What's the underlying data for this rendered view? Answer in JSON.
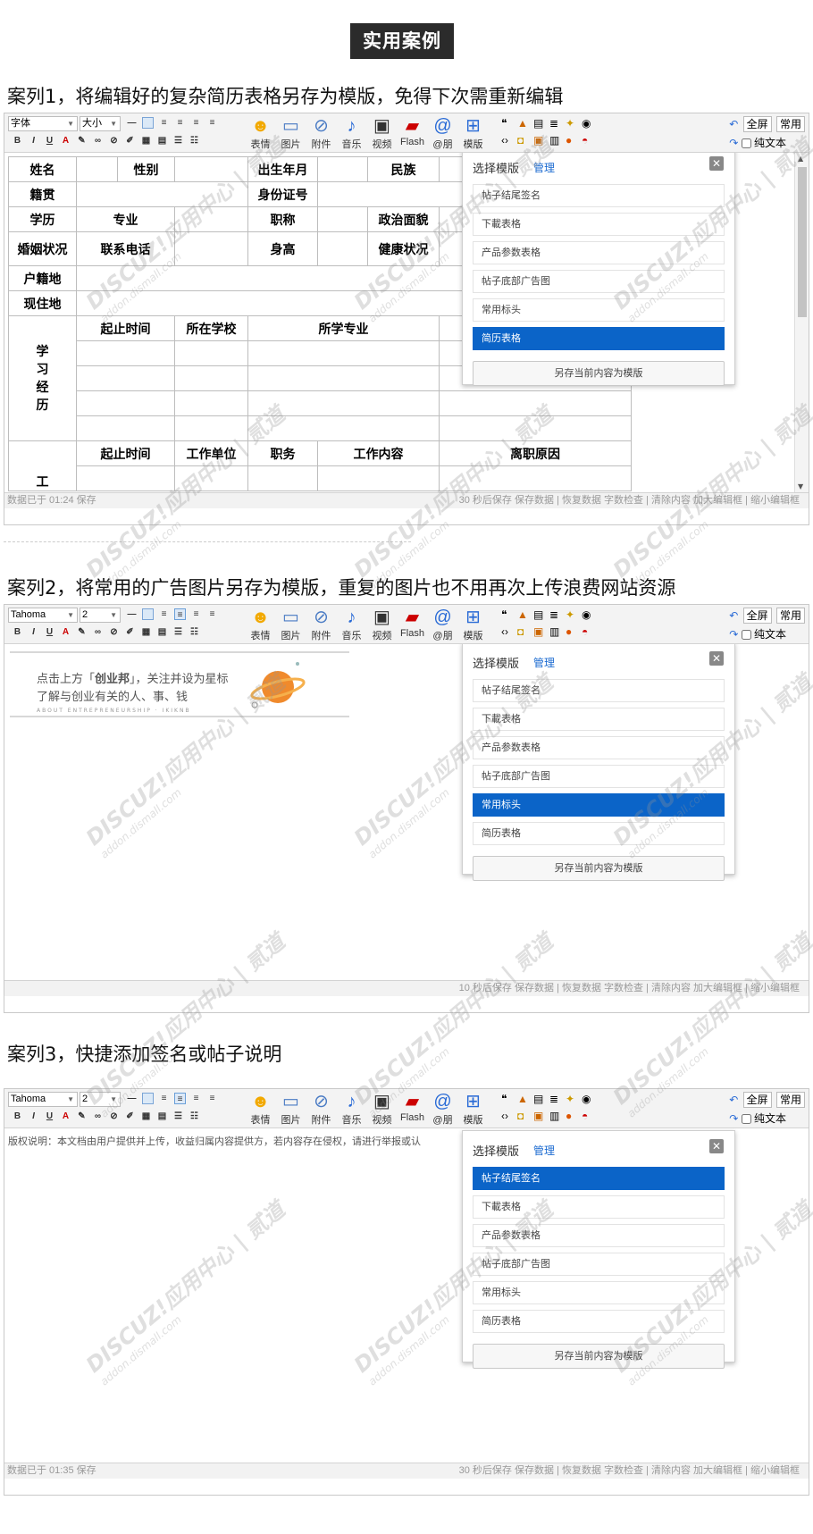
{
  "page_title": "实用案例",
  "cases": [
    {
      "title": "案列1，将编辑好的复杂简历表格另存为模版，免得下次需重新编辑",
      "status_left": "数据已于 01:24 保存",
      "status_right": "30 秒后保存 保存数据 | 恢复数据   字数检查 | 清除内容   加大编辑框 | 缩小编辑框",
      "font_value": "字体",
      "size_value": "大小"
    },
    {
      "title": "案列2，将常用的广告图片另存为模版，重复的图片也不用再次上传浪费网站资源",
      "status_left": "",
      "status_right": "10 秒后保存 保存数据 | 恢复数据   字数检查 | 清除内容   加大编辑框 | 缩小编辑框",
      "font_value": "Tahoma",
      "size_value": "2"
    },
    {
      "title": "案列3，快捷添加签名或帖子说明",
      "status_left": "数据已于 01:35 保存",
      "status_right": "30 秒后保存 保存数据 | 恢复数据   字数检查 | 清除内容   加大编辑框 | 缩小编辑框",
      "font_value": "Tahoma",
      "size_value": "2"
    }
  ],
  "toolbar": {
    "big_buttons": [
      "表情",
      "图片",
      "附件",
      "音乐",
      "视频",
      "Flash",
      "@朋",
      "模版"
    ],
    "fullscreen": "全屏",
    "common": "常用",
    "plain_text": "纯文本"
  },
  "template_popup": {
    "title": "选择模版",
    "manage": "管理",
    "items": [
      "帖子结尾签名",
      "下載表格",
      "产品参数表格",
      "帖子底部广告图",
      "常用标头",
      "简历表格"
    ],
    "save_label": "另存当前内容为模版",
    "selected_index": [
      5,
      4,
      0
    ]
  },
  "resume": {
    "row1": [
      "姓名",
      "",
      "性别",
      "",
      "出生年月",
      "",
      "民族",
      ""
    ],
    "row2": [
      "籍贯",
      "",
      "身份证号",
      ""
    ],
    "row3": [
      "学历",
      "专业",
      "",
      "职称",
      "",
      "政治面貌"
    ],
    "row4": [
      "婚姻状况",
      "联系电话",
      "",
      "身高",
      "",
      "健康状况"
    ],
    "row5": [
      "户籍地"
    ],
    "row6": [
      "现住地"
    ],
    "edu_label": "学习经历",
    "edu_headers": [
      "起止时间",
      "所在学校",
      "所学专业"
    ],
    "work_label": "工",
    "work_headers": [
      "起止时间",
      "工作单位",
      "职务",
      "工作内容",
      "离职原因"
    ]
  },
  "ad": {
    "line1_pre": "点击上方「",
    "line1_bold": "创业邦",
    "line1_post": "」，关注并设为星标",
    "line2": "了解与创业有关的人、事、钱",
    "line3": "ABOUT  ENTREPRENEURSHIP  ·  IKIKNB"
  },
  "case3_text": "版权说明：本文档由用户提供并上传，收益归属内容提供方，若内容存在侵权，请进行举报或认",
  "watermark": {
    "main": "DISCUZ!应用中心 | 贰道",
    "sub": "addon.dismall.com"
  }
}
